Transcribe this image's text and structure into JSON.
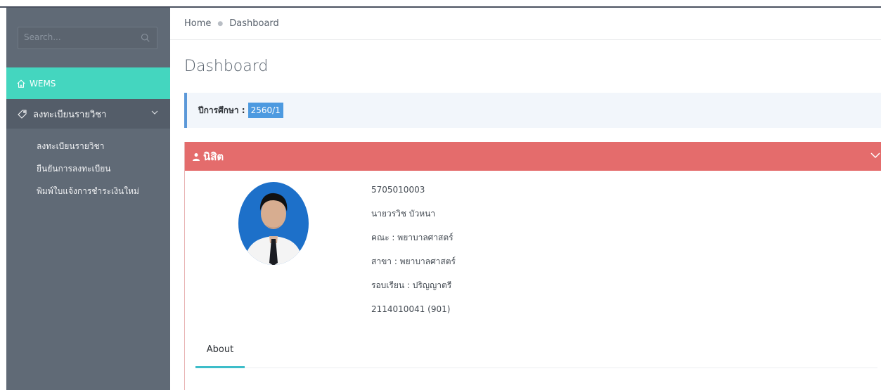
{
  "search": {
    "placeholder": "Search..."
  },
  "sidebar": {
    "active_item": "WEMS",
    "group_label": "ลงทะเบียนรายวิชา",
    "items": [
      {
        "label": "ลงทะเบียนรายวิชา"
      },
      {
        "label": "ยืนยันการลงทะเบียน"
      },
      {
        "label": "พิมพ์ใบแจ้งการชำระเงินใหม่"
      }
    ]
  },
  "breadcrumb": {
    "home": "Home",
    "current": "Dashboard"
  },
  "page": {
    "title": "Dashboard"
  },
  "academic_year": {
    "label": "ปีการศึกษา :",
    "value": "2560/1"
  },
  "student_panel": {
    "title": "นิสิต",
    "student_id": "5705010003",
    "name": "นายวรวิช บัวหนา",
    "faculty": "คณะ : พยาบาลศาสตร์",
    "major": "สาขา : พยาบาลศาสตร์",
    "program": "รอบเรียน : ปริญญาตรี",
    "code": "2114010041 (901)"
  },
  "tabs": [
    {
      "label": "About"
    }
  ],
  "colors": {
    "accent_active": "#44d6bf",
    "panel_header": "#e46c6c",
    "year_badge": "#4d9ae0",
    "sidebar": "#606a76"
  },
  "icons": [
    "search-icon",
    "home-icon",
    "tag-icon",
    "chevron-down-icon",
    "user-icon"
  ]
}
